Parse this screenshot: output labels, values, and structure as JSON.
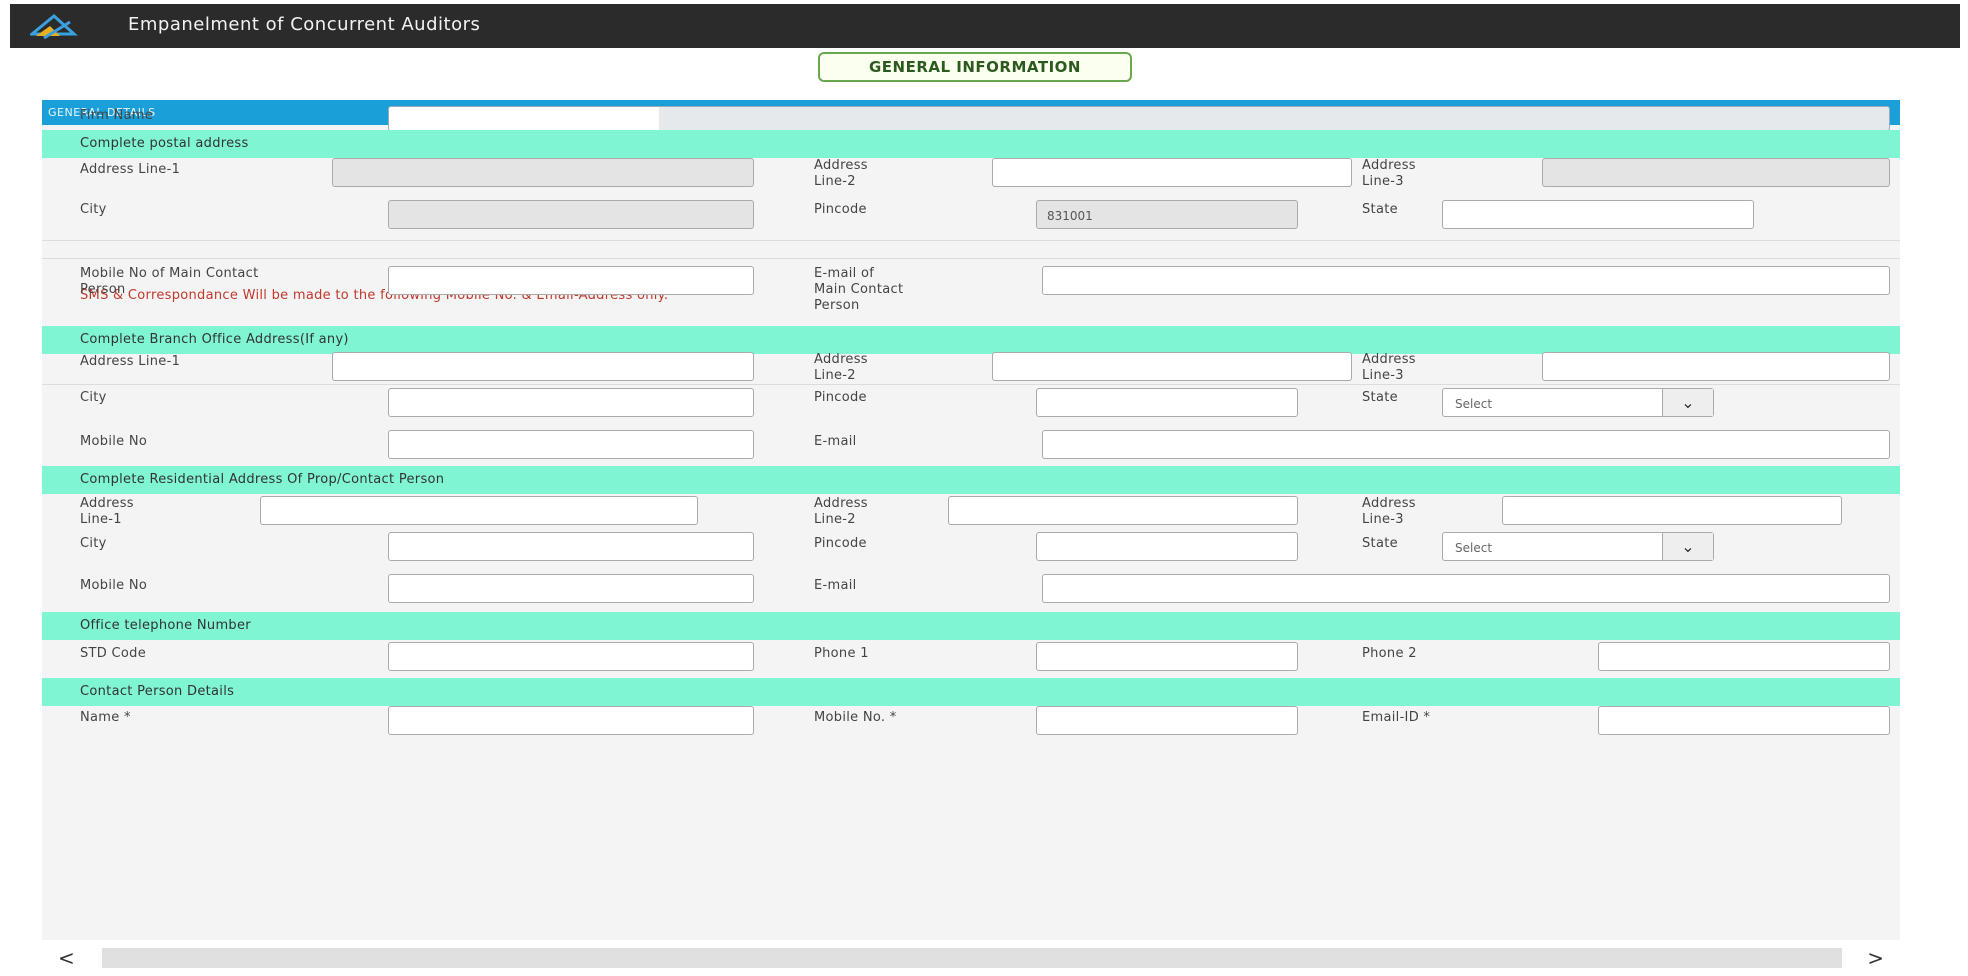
{
  "window": {
    "title": "Empanelment of Concurrent Auditors"
  },
  "tab_button": "GENERAL INFORMATION",
  "general_details": "GENERAL DETAILS",
  "firm": {
    "label": "Firm Name",
    "value": ""
  },
  "postal": {
    "heading": "Complete postal address",
    "addr1_label": "Address Line-1",
    "addr2_label": "Address Line-2",
    "addr3_label": "Address Line-3",
    "city_label": "City",
    "pincode_label": "Pincode",
    "pincode_value": "831001",
    "state_label": "State"
  },
  "note": "SMS & Correspondance Will be made to the following Mobile No. & Email-Address only.",
  "main_contact": {
    "mobile_label": "Mobile No of Main Contact Person",
    "email_label": "E-mail of Main Contact Person"
  },
  "branch": {
    "heading": "Complete Branch Office Address(If any)",
    "addr1_label": "Address Line-1",
    "addr2_label": "Address Line-2",
    "addr3_label": "Address Line-3",
    "city_label": "City",
    "pincode_label": "Pincode",
    "state_label": "State",
    "state_value": "Select",
    "mobile_label": "Mobile No",
    "email_label": "E-mail"
  },
  "residential": {
    "heading": "Complete Residential Address Of Prop/Contact Person",
    "addr1_label": "Address Line-1",
    "addr2_label": "Address Line-2",
    "addr3_label": "Address Line-3",
    "city_label": "City",
    "pincode_label": "Pincode",
    "state_label": "State",
    "state_value": "Select",
    "mobile_label": "Mobile No",
    "email_label": "E-mail"
  },
  "office_phone": {
    "heading": "Office telephone Number",
    "std_label": "STD Code",
    "phone1_label": "Phone 1",
    "phone2_label": "Phone 2"
  },
  "contact_person": {
    "heading": "Contact Person Details",
    "name_label": "Name *",
    "mobile_label": "Mobile No. *",
    "email_label": "Email-ID *"
  },
  "scrollbar": {
    "left": "<",
    "right": ">"
  },
  "colors": {
    "topbar": "#2b2b2b",
    "blue_header": "#1a9fd9",
    "section": "#7ff5d4",
    "note": "#c0392b"
  },
  "icons": [
    "app-logo-icon",
    "chevron-down-icon",
    "scroll-left-icon",
    "scroll-right-icon"
  ]
}
